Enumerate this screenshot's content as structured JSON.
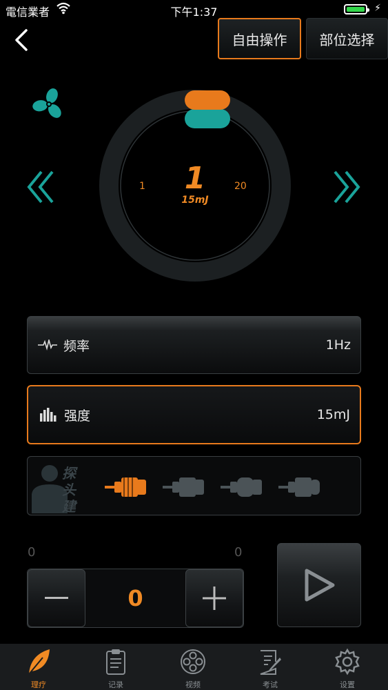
{
  "status_bar": {
    "carrier": "電信業者",
    "time": "下午1:37"
  },
  "header": {
    "free_mode_label": "自由操作",
    "part_select_label": "部位选择"
  },
  "dial": {
    "value": "1",
    "unit_value": "15mJ",
    "min": "1",
    "max": "20",
    "level_fraction": 0.05
  },
  "settings": {
    "frequency": {
      "label": "频率",
      "value": "1Hz"
    },
    "intensity": {
      "label": "强度",
      "value": "15mJ"
    }
  },
  "probe_panel": {
    "suggestion_label": "探头建议",
    "probes": [
      "probe-1",
      "probe-2",
      "probe-3",
      "probe-4"
    ],
    "selected_index": 0
  },
  "counter": {
    "min": "0",
    "max": "0",
    "value": "0"
  },
  "tabbar": {
    "tabs": [
      {
        "label": "理疗",
        "icon": "leaf-icon",
        "active": true
      },
      {
        "label": "记录",
        "icon": "clipboard-icon",
        "active": false
      },
      {
        "label": "视频",
        "icon": "film-reel-icon",
        "active": false
      },
      {
        "label": "考试",
        "icon": "exam-pen-icon",
        "active": false
      },
      {
        "label": "设置",
        "icon": "gear-icon",
        "active": false
      }
    ]
  },
  "colors": {
    "accent": "#f08a24",
    "teal": "#1aa39a",
    "background": "#000000"
  }
}
